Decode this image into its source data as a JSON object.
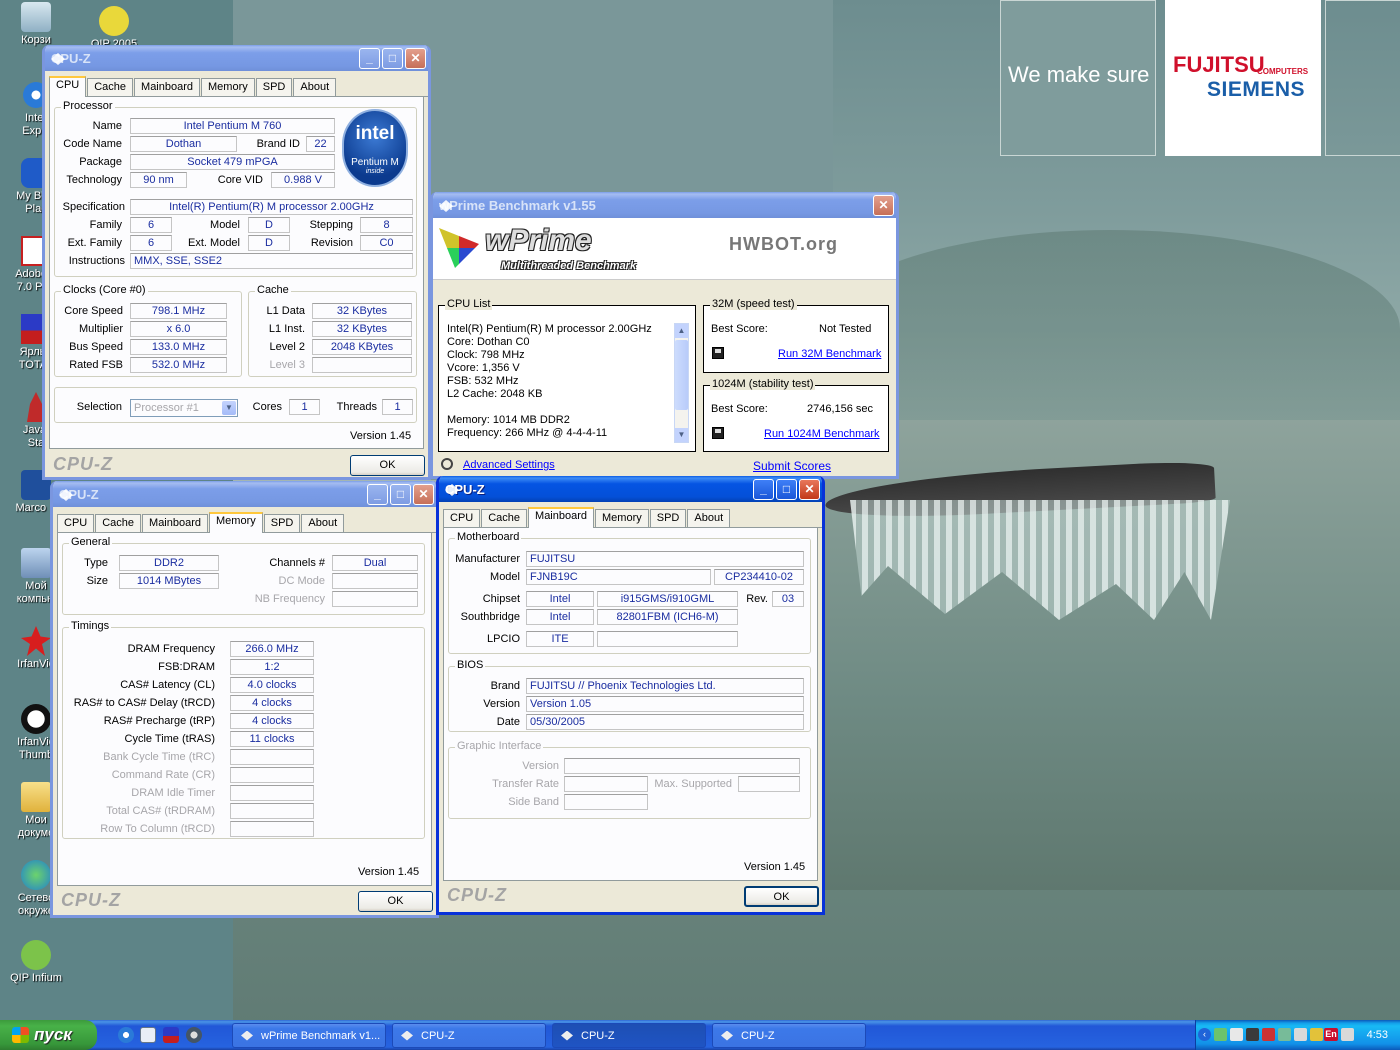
{
  "desktop": {
    "slogan": "We make sure",
    "logo_fujitsu": "FUJITSU",
    "logo_computers": "COMPUTERS",
    "logo_siemens": "SIEMENS",
    "icons": [
      {
        "label": "Корзи"
      },
      {
        "label": "QIP 2005"
      },
      {
        "label": "Inter\nExplo"
      },
      {
        "label": "My Blue\nPlac"
      },
      {
        "label": "Adobe A\n7.0 Prof"
      },
      {
        "label": "Ярлык\nTOTAL"
      },
      {
        "label": "Java \nSta"
      },
      {
        "label": "Marco P"
      },
      {
        "label": "Мой\nкомпью"
      },
      {
        "label": "IrfanVie"
      },
      {
        "label": "IrfanVie\nThumb"
      },
      {
        "label": "Мои\nдокуме"
      },
      {
        "label": "Сетево\nокруже"
      },
      {
        "label": "QIP Infium"
      }
    ]
  },
  "cpuz_cpu": {
    "title": "CPU-Z",
    "tabs": [
      "CPU",
      "Cache",
      "Mainboard",
      "Memory",
      "SPD",
      "About"
    ],
    "active_tab": "CPU",
    "processor_legend": "Processor",
    "labels": {
      "name": "Name",
      "code_name": "Code Name",
      "brand_id": "Brand ID",
      "package": "Package",
      "technology": "Technology",
      "core_vid": "Core VID",
      "specification": "Specification",
      "family": "Family",
      "model": "Model",
      "stepping": "Stepping",
      "ext_family": "Ext. Family",
      "ext_model": "Ext. Model",
      "revision": "Revision",
      "instructions": "Instructions"
    },
    "values": {
      "name": "Intel Pentium M 760",
      "code_name": "Dothan",
      "brand_id": "22",
      "package": "Socket 479 mPGA",
      "technology": "90 nm",
      "core_vid": "0.988 V",
      "specification": "Intel(R) Pentium(R) M processor 2.00GHz",
      "family": "6",
      "model": "D",
      "stepping": "8",
      "ext_family": "6",
      "ext_model": "D",
      "revision": "C0",
      "instructions": "MMX, SSE, SSE2"
    },
    "intel_logo": {
      "text": "intel",
      "sub": "Pentium M",
      "inside": "inside"
    },
    "clocks_legend": "Clocks (Core #0)",
    "clocks": [
      {
        "label": "Core Speed",
        "value": "798.1 MHz"
      },
      {
        "label": "Multiplier",
        "value": "x 6.0"
      },
      {
        "label": "Bus Speed",
        "value": "133.0 MHz"
      },
      {
        "label": "Rated FSB",
        "value": "532.0 MHz"
      }
    ],
    "cache_legend": "Cache",
    "cache": [
      {
        "label": "L1 Data",
        "value": "32 KBytes"
      },
      {
        "label": "L1 Inst.",
        "value": "32 KBytes"
      },
      {
        "label": "Level 2",
        "value": "2048 KBytes"
      },
      {
        "label": "Level 3",
        "value": ""
      }
    ],
    "selection_label": "Selection",
    "selection_value": "Processor #1",
    "cores_label": "Cores",
    "cores_value": "1",
    "threads_label": "Threads",
    "threads_value": "1",
    "version": "Version 1.45",
    "brand": "CPU-Z",
    "ok": "OK"
  },
  "cpuz_memory": {
    "title": "CPU-Z",
    "tabs": [
      "CPU",
      "Cache",
      "Mainboard",
      "Memory",
      "SPD",
      "About"
    ],
    "active_tab": "Memory",
    "general_legend": "General",
    "type_label": "Type",
    "type_value": "DDR2",
    "size_label": "Size",
    "size_value": "1014 MBytes",
    "channels_label": "Channels #",
    "channels_value": "Dual",
    "dc_mode_label": "DC Mode",
    "nb_freq_label": "NB Frequency",
    "timings_legend": "Timings",
    "timings": [
      {
        "label": "DRAM Frequency",
        "value": "266.0 MHz",
        "dim": false
      },
      {
        "label": "FSB:DRAM",
        "value": "1:2",
        "dim": false
      },
      {
        "label": "CAS# Latency (CL)",
        "value": "4.0 clocks",
        "dim": false
      },
      {
        "label": "RAS# to CAS# Delay (tRCD)",
        "value": "4 clocks",
        "dim": false
      },
      {
        "label": "RAS# Precharge (tRP)",
        "value": "4 clocks",
        "dim": false
      },
      {
        "label": "Cycle Time (tRAS)",
        "value": "11 clocks",
        "dim": false
      },
      {
        "label": "Bank Cycle Time (tRC)",
        "value": "",
        "dim": true
      },
      {
        "label": "Command Rate (CR)",
        "value": "",
        "dim": true
      },
      {
        "label": "DRAM Idle Timer",
        "value": "",
        "dim": true
      },
      {
        "label": "Total CAS# (tRDRAM)",
        "value": "",
        "dim": true
      },
      {
        "label": "Row To Column (tRCD)",
        "value": "",
        "dim": true
      }
    ],
    "version": "Version 1.45",
    "brand": "CPU-Z",
    "ok": "OK"
  },
  "cpuz_mainboard": {
    "title": "CPU-Z",
    "tabs": [
      "CPU",
      "Cache",
      "Mainboard",
      "Memory",
      "SPD",
      "About"
    ],
    "active_tab": "Mainboard",
    "motherboard_legend": "Motherboard",
    "manufacturer_label": "Manufacturer",
    "manufacturer": "FUJITSU",
    "model_label": "Model",
    "model": "FJNB19C",
    "model_rev": "CP234410-02",
    "chipset_label": "Chipset",
    "chipset_vendor": "Intel",
    "chipset": "i915GMS/i910GML",
    "rev_label": "Rev.",
    "rev": "03",
    "southbridge_label": "Southbridge",
    "southbridge_vendor": "Intel",
    "southbridge": "82801FBM (ICH6-M)",
    "lpcio_label": "LPCIO",
    "lpcio": "ITE",
    "bios_legend": "BIOS",
    "bios_brand_label": "Brand",
    "bios_brand": "FUJITSU // Phoenix Technologies Ltd.",
    "bios_version_label": "Version",
    "bios_version": "Version 1.05",
    "bios_date_label": "Date",
    "bios_date": "05/30/2005",
    "gi_legend": "Graphic Interface",
    "gi_version_label": "Version",
    "gi_transfer_label": "Transfer Rate",
    "gi_max_label": "Max. Supported",
    "gi_side_label": "Side Band",
    "version": "Version 1.45",
    "brand": "CPU-Z",
    "ok": "OK"
  },
  "wprime": {
    "title": "wPrime Benchmark v1.55",
    "logo": "wPrime",
    "logo_sub": "Multithreaded Benchmark",
    "hwbot": "HWBOT.org",
    "cpu_list_legend": "CPU List",
    "cpu_list": [
      "Intel(R) Pentium(R) M processor 2.00GHz",
      "Core: Dothan C0",
      "Clock: 798 MHz",
      "Vcore: 1,356 V",
      "FSB: 532 MHz",
      "L2 Cache: 2048 KB",
      "",
      "Memory: 1014 MB DDR2",
      "Frequency: 266 MHz @ 4-4-4-11"
    ],
    "speed_legend": "32M (speed test)",
    "speed_best_label": "Best Score:",
    "speed_best": "Not Tested",
    "speed_run": "Run 32M Benchmark",
    "stab_legend": "1024M (stability test)",
    "stab_best_label": "Best Score:",
    "stab_best": "2746,156 sec",
    "stab_run": "Run 1024M Benchmark",
    "advanced": "Advanced Settings",
    "submit": "Submit Scores"
  },
  "taskbar": {
    "start": "пуск",
    "tasks": [
      "wPrime Benchmark v1...",
      "CPU-Z",
      "CPU-Z",
      "CPU-Z"
    ],
    "lang": "En",
    "clock": "4:53"
  }
}
